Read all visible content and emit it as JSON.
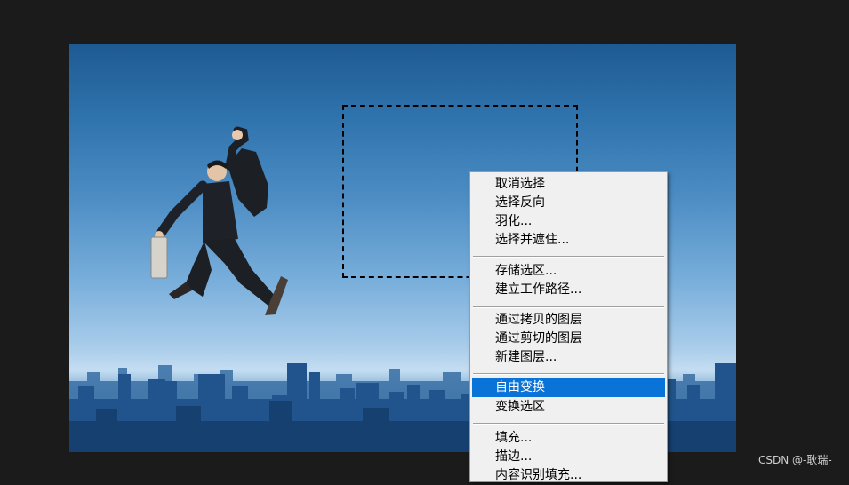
{
  "canvas": {
    "background": "#1b1b1b",
    "image_subject": "businessman jumping over city skyline"
  },
  "context_menu": {
    "groups": [
      [
        "取消选择",
        "选择反向",
        "羽化...",
        "选择并遮住..."
      ],
      [
        "存储选区...",
        "建立工作路径..."
      ],
      [
        "通过拷贝的图层",
        "通过剪切的图层",
        "新建图层..."
      ],
      [
        "自由变换",
        "变换选区"
      ],
      [
        "填充...",
        "描边...",
        "内容识别填充..."
      ]
    ],
    "highlighted_item": "自由变换",
    "highlight_color": "#0a73d8"
  },
  "watermark": "CSDN @-耿瑞-"
}
